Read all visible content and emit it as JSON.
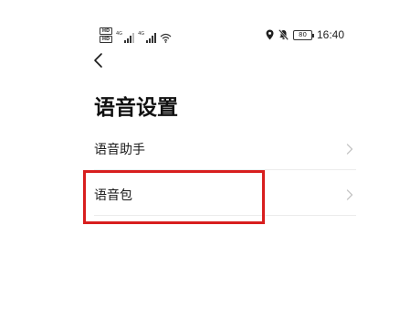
{
  "status_bar": {
    "sim1_label": "HD",
    "sim2_label": "HD",
    "signal1_tag": "4G",
    "signal2_tag": "4G",
    "battery_level": "80",
    "time": "16:40",
    "icons": [
      "location-icon",
      "mute-icon",
      "wifi-icon"
    ]
  },
  "nav": {
    "back_icon": "chevron-left-icon"
  },
  "page": {
    "title": "语音设置"
  },
  "list": {
    "items": [
      {
        "label": "语音助手",
        "icon": "chevron-right-icon"
      },
      {
        "label": "语音包",
        "icon": "chevron-right-icon"
      }
    ]
  },
  "colors": {
    "highlight": "#d81e1e",
    "chevron": "#c4c4c4",
    "divider": "#ececec"
  }
}
